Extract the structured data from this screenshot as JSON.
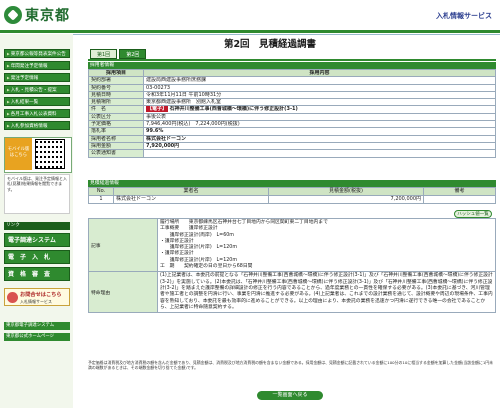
{
  "header": {
    "logo": "東京都",
    "service": "入札情報サービス"
  },
  "sidebar": {
    "buttons": [
      "東京都公報等発表案件公告",
      "年間発注予定情報",
      "発注予定情報",
      "入札・見積公告・提案",
      "入札結果一覧",
      "各月工事入札公表資料",
      "入札参加資格情報"
    ],
    "mobile_label": "モバイル版",
    "mobile_sub": "はこちら",
    "qr_note": "モバイル版は、発注予定情報と入札(見積)結果情報を閲覧できます。",
    "links_head": "リンク",
    "big_buttons": [
      "電子調達システム(TOP)",
      "電　子　入　札",
      "資　格　審　査"
    ],
    "inquiry_title": "お問合せはこちら",
    "inquiry_sub": "入札情報サービス",
    "footer_links": [
      "東京都電子調達システム",
      "東京都公式ホームページ"
    ]
  },
  "page": {
    "title": "第2回　見積経過調書",
    "tabs": [
      "第1回",
      "第2回"
    ]
  },
  "sections": {
    "info": "採用者情報",
    "result": "見積経過情報"
  },
  "info_table": {
    "col1": "採用項目",
    "col2": "採用内容",
    "rows": [
      {
        "k": "契約部署",
        "v": "建設局西建設事務所庶務課"
      },
      {
        "k": "契約番号",
        "v": "03-00273"
      },
      {
        "k": "見積日時",
        "v": "令和3年11月11日 午前10時31分"
      },
      {
        "k": "見積場所",
        "v": "東京都西建設事務所　別館入札室"
      },
      {
        "k": "件　名",
        "badge": "【電子】",
        "v": "石神井川整備工事(西曹城橋〜環橋)に伴う修正設計(3-1)"
      },
      {
        "k": "公表区分",
        "v": "事後公表"
      },
      {
        "k": "予定価格",
        "v": "7,946,400円(税込)　7,224,000円(税抜)"
      },
      {
        "k": "落札率",
        "v": "99.6%"
      },
      {
        "k": "採用者名称",
        "v": "株式会社ドーコン"
      },
      {
        "k": "採用金額",
        "v": "7,920,000円"
      },
      {
        "k": "公表通知書",
        "v": ""
      }
    ]
  },
  "result_table": {
    "headers": [
      "No.",
      "業者名",
      "見積金額(税抜)",
      "備考"
    ],
    "rows": [
      {
        "no": "1",
        "name": "株式会社ドーコン",
        "amount": "7,200,000円",
        "note": ""
      }
    ],
    "hide_button": "ハッシュ値一覧"
  },
  "detail": {
    "kiji_label": "記事",
    "kiji_lines": [
      "履行場所　　東京都練馬区石神井台七丁目地内から同区関町東二丁目地内まで",
      "工事概要　　護岸修正設計",
      "　　護岸修正設計(両岸)　L=60m",
      "・護岸修正設計",
      "　　護岸修正設計(片岸)　L=120m",
      "・護岸修正設計",
      "　　護岸修正設計(片岸)　L=120m",
      "工　期　　契約確定の日の翌日から68日間"
    ],
    "tokki_label": "特命理由",
    "tokki": "(1)上記業者は、本委託の前提となる「石神井川整備工事(西曹城橋〜環橋)に伴う修正設計(3-1)」及び「石神井川整備工事(西曹城橋〜環橋)に伴う修正設計(3-2)」を実施している。(2)本委託は、「石神井川整備工事(西曹城橋〜環橋)に伴う修正設計(3-1)」及び「石神井川整備工事(西曹城橋〜環橋)に伴う修正設計(3-2)」を踏まえた護岸整備の詳細設計の修正を行う内容であることから、過年度業務との一貫性を確保する必要がある。(3)本委託に基づき、河川管理者や施工者との調整を円滑に行い、事業を円滑に推進する必要がある。(4)上記業者は、これまでの設計業務を通じて、設計概要や周辺の現場条件、工事内容を熟知しており、本委託を最も効率的に進めることができる。以上の理由により、本委託の業務を迅速かつ円滑に遂行できる唯一の会社であることから、上記業者に特命随意契約する。"
  },
  "footnote": "予定価格は消費税及び地方消費税の額を含んだ金額であり、見積金額は、消費税及び地方消費税の額を含まない金額である。採用金額は、見積金額に記載されている金額に100分の10に相当する金額を加算した金額(当該金額に1円未満の端数があるときは、その端数金額を切り捨てた金額)です。",
  "back_button": "一覧画面へ戻る"
}
